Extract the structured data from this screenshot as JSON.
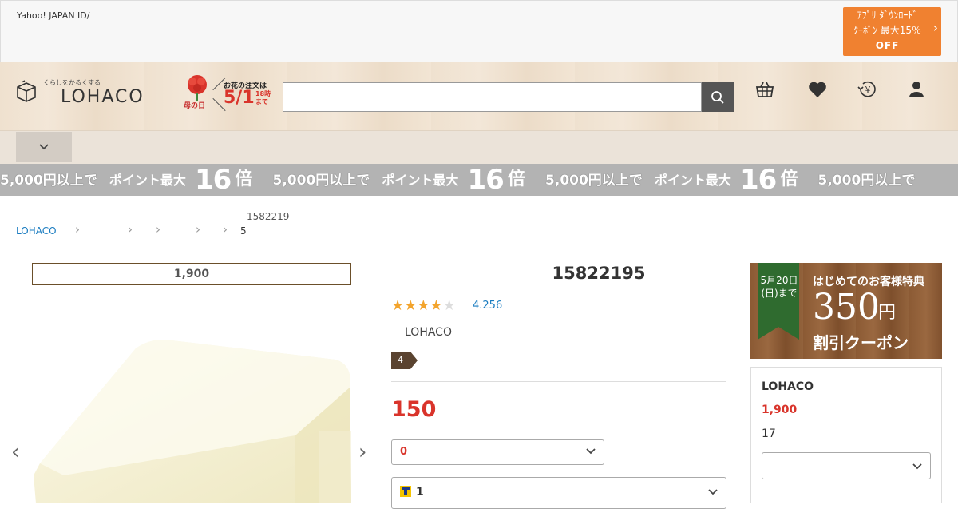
{
  "topbar": {
    "yahoo_id": "Yahoo! JAPAN ID/",
    "promo_line1": "ｱﾌﾟﾘ ﾀﾞｳﾝﾛｰﾄﾞ",
    "promo_line2": "ｸｰﾎﾟﾝ 最大15％",
    "promo_line3": "OFF"
  },
  "header": {
    "logo_tagline": "くらしをかるくする",
    "logo_brand": "LOHACO",
    "mothers_day": {
      "label": "母の日",
      "message": "お花の注文は",
      "date": "5/1",
      "time_line1": "18時",
      "time_line2": "まで"
    },
    "search": {
      "placeholder": ""
    }
  },
  "banner": {
    "segments": [
      {
        "a": "5,000円以上で",
        "b": "ポイント最大",
        "c": "16",
        "d": "倍"
      },
      {
        "a": "5,000円以上で",
        "b": "ポイント最大",
        "c": "16",
        "d": "倍"
      },
      {
        "a": "5,000円以上で",
        "b": "ポイント最大",
        "c": "16",
        "d": "倍"
      },
      {
        "a": "5,000円以上で",
        "b": "",
        "c": "",
        "d": ""
      }
    ]
  },
  "breadcrumb": {
    "home": "LOHACO",
    "product_id": "1582219",
    "last": "5"
  },
  "product": {
    "free_ship_threshold": "1,900",
    "title": "15822195",
    "rating_value": 4,
    "rating_count": "4.256",
    "brand": "LOHACO",
    "tag": "4",
    "price": "150",
    "select_qty": "0",
    "tpoint": "1"
  },
  "coupon": {
    "deadline_line1": "5月20日",
    "deadline_line2": "(日)まで",
    "headline": "はじめてのお客様特典",
    "amount": "350",
    "unit": "円",
    "label": "割引クーポン"
  },
  "seller": {
    "name": "LOHACO",
    "price": "1,900",
    "stock": "17"
  }
}
